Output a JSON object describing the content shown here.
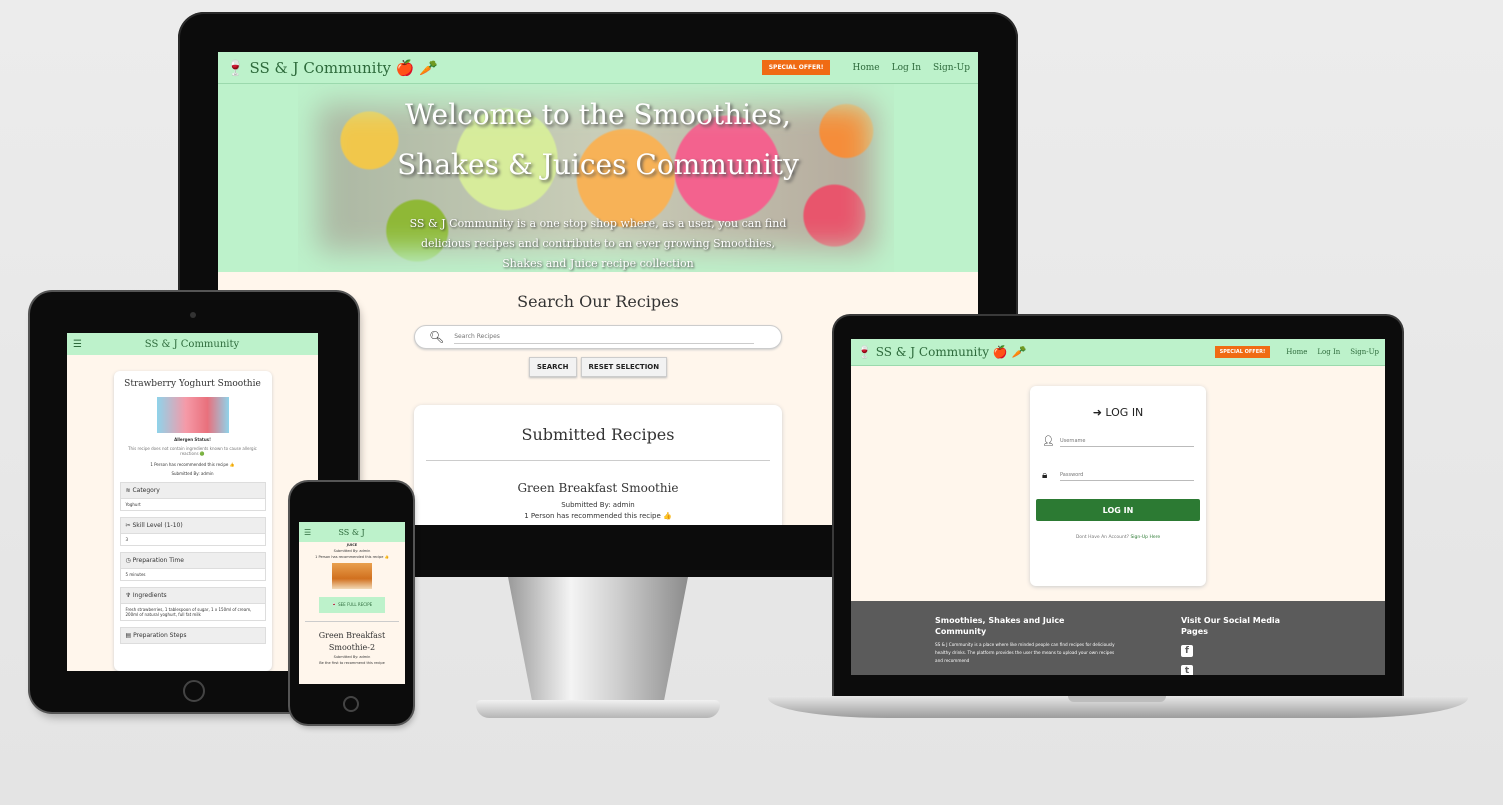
{
  "desktop": {
    "nav": {
      "brand": "🍷 SS & J Community 🍎 🥕",
      "offer": "SPECIAL OFFER!",
      "links": [
        "Home",
        "Log In",
        "Sign-Up"
      ]
    },
    "hero": {
      "title_line1": "Welcome to the Smoothies,",
      "title_line2": "Shakes & Juices Community",
      "text": "SS & J Community is a one stop shop where, as a user, you can find delicious recipes and contribute to an ever growing Smoothies, Shakes and Juice recipe collection"
    },
    "search": {
      "heading": "Search Our Recipes",
      "placeholder": "Search Recipes",
      "search_btn": "SEARCH",
      "reset_btn": "RESET SELECTION"
    },
    "recipes": {
      "title": "Submitted Recipes",
      "first": {
        "name": "Green Breakfast Smoothie",
        "submitted": "Submitted By: admin",
        "recommend": "1 Person has recommended this recipe 👍"
      }
    }
  },
  "tablet": {
    "brand": "SS & J Community",
    "menu_icon": "☰",
    "recipe": {
      "title": "Strawberry Yoghurt Smoothie",
      "allergen_label": "Allergen Status!",
      "allergen_text": "This recipe does not contain ingredients known to cause allergic reactions 🟢",
      "recommend": "1 Person has recommended this recipe 👍",
      "submitted": "Submitted By: admin",
      "sections": [
        {
          "title": "Category",
          "icon": "≋",
          "value": "Yoghurt"
        },
        {
          "title": "Skill Level (1-10)",
          "icon": "✂",
          "value": "3"
        },
        {
          "title": "Preparation Time",
          "icon": "◷",
          "value": "5 minutes"
        },
        {
          "title": "Ingredients",
          "icon": "♆",
          "value": "Fresh strawberries, 1 tablespoon of sugar, 1 x 150ml of cream, 200ml of natural yoghurt, full fat milk"
        },
        {
          "title": "Preparation Steps",
          "icon": "▤",
          "value": ""
        }
      ]
    }
  },
  "phone": {
    "brand": "SS & J",
    "menu_icon": "☰",
    "top_lines": [
      "JUICE",
      "Submitted By: admin",
      "1 Person has recommended this recipe 👍"
    ],
    "see_full": "🍷 SEE FULL RECIPE",
    "next_recipe": {
      "name": "Green Breakfast Smoothie-2",
      "submitted": "Submitted By: admin",
      "recommend": "Be the first to recommend this recipe"
    }
  },
  "laptop": {
    "nav": {
      "brand": "🍷 SS & J Community 🍎 🥕",
      "offer": "SPECIAL OFFER!",
      "links": [
        "Home",
        "Log In",
        "Sign-Up"
      ]
    },
    "login": {
      "title": "➜ LOG IN",
      "username_placeholder": "Username",
      "password_placeholder": "Password",
      "button": "LOG IN",
      "no_account": "Dont Have An Account?",
      "signup_link": "Sign-Up Here"
    },
    "footer": {
      "col1_title": "Smoothies, Shakes and Juice Community",
      "col1_text": "SS & J Community is a place where like minded people can find recipes for deliciously healthy drinks. The platform provides the user the means to upload your own recipes and recommend",
      "col2_title": "Visit Our Social Media Pages",
      "icons": [
        "facebook-icon",
        "twitter-icon"
      ]
    }
  },
  "colors": {
    "nav_green": "#bdf2cb",
    "brand_text": "#2d6a3b",
    "offer_orange": "#f06b14",
    "login_button": "#2c7a33",
    "page_bg": "#fff6ec",
    "footer_grey": "#5b5b5b"
  }
}
